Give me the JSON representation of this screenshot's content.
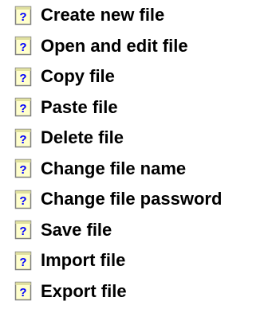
{
  "menu": {
    "items": [
      {
        "label": "Create new file",
        "icon": "help-document-icon"
      },
      {
        "label": "Open and edit file",
        "icon": "help-document-icon"
      },
      {
        "label": "Copy file",
        "icon": "help-document-icon"
      },
      {
        "label": "Paste file",
        "icon": "help-document-icon"
      },
      {
        "label": "Delete file",
        "icon": "help-document-icon"
      },
      {
        "label": "Change file name",
        "icon": "help-document-icon"
      },
      {
        "label": "Change file password",
        "icon": "help-document-icon"
      },
      {
        "label": "Save file",
        "icon": "help-document-icon"
      },
      {
        "label": "Import file",
        "icon": "help-document-icon"
      },
      {
        "label": "Export file",
        "icon": "help-document-icon"
      }
    ]
  },
  "colors": {
    "text": "#000000",
    "icon_page": "#ffffcc",
    "icon_border": "#808080",
    "icon_mark": "#0000ff"
  }
}
